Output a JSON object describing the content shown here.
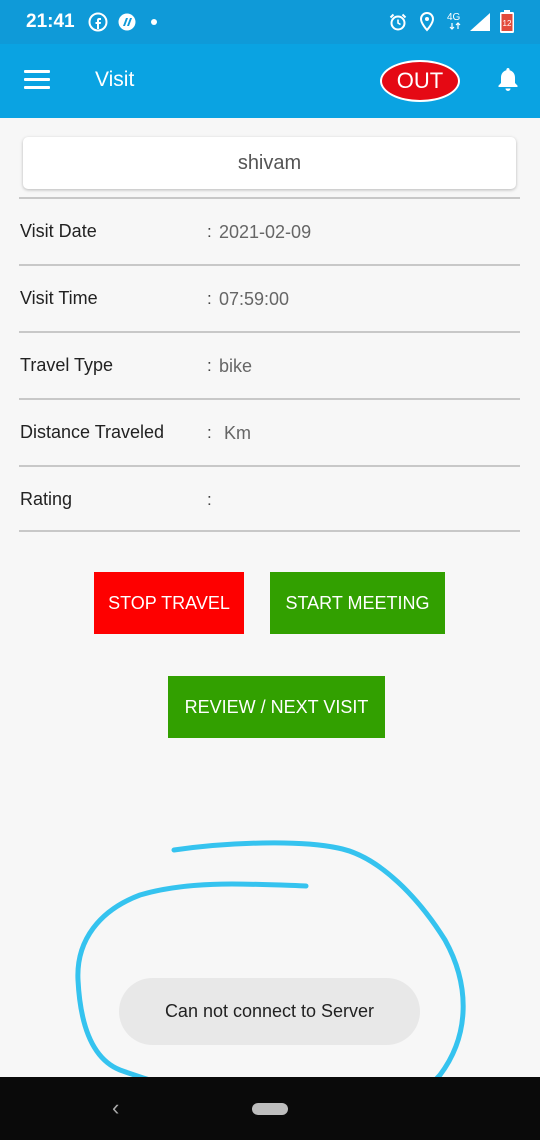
{
  "status_bar": {
    "time": "21:41",
    "icons": [
      "facebook-icon",
      "app-notification-icon",
      "dot-icon",
      "alarm-icon",
      "location-icon",
      "network-4g-icon",
      "signal-icon",
      "battery-icon"
    ],
    "network": "4G",
    "battery_level": "12"
  },
  "app_bar": {
    "title": "Visit",
    "out_label": "OUT",
    "colors": {
      "bar": "#0aa3e2",
      "out_button": "#e50914"
    }
  },
  "name_card": {
    "value": "shivam"
  },
  "details": [
    {
      "label": "Visit Date",
      "value": "2021-02-09"
    },
    {
      "label": "Visit Time",
      "value": "07:59:00"
    },
    {
      "label": "Travel Type",
      "value": "bike"
    },
    {
      "label": "Distance Traveled",
      "value": "Km"
    },
    {
      "label": "Rating",
      "value": ""
    }
  ],
  "colon": ":",
  "buttons": {
    "stop_travel": "STOP TRAVEL",
    "start_meeting": "START MEETING",
    "review_next_visit": "REVIEW / NEXT VISIT",
    "colors": {
      "stop": "#fe0000",
      "go": "#32a000"
    }
  },
  "toast": {
    "message": "Can not connect to Server"
  },
  "nav_bar": {
    "back": "‹"
  }
}
